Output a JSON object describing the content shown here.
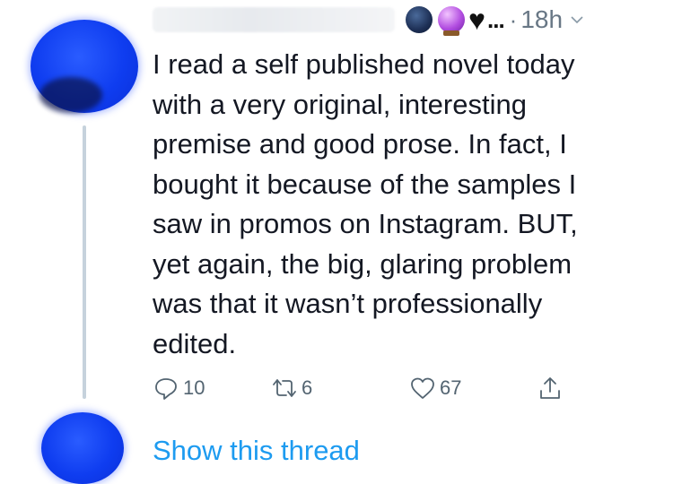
{
  "tweet": {
    "author_emojis": [
      "globe-emoji",
      "crystal-ball-emoji",
      "black-heart-emoji"
    ],
    "ellipsis": "...",
    "separator": "·",
    "timestamp": "18h",
    "text": "I read a self published novel today\nwith a very original, interesting\npremise and good prose. In fact, I\nbought it because of the samples I\nsaw in promos on Instagram. BUT,\nyet again, the big, glaring problem\nwas that it wasn’t professionally\nedited.",
    "actions": {
      "reply_count": "10",
      "retweet_count": "6",
      "like_count": "67"
    }
  },
  "thread_link": "Show this thread",
  "colors": {
    "text": "#141823",
    "muted": "#687785",
    "link": "#1d9bf0",
    "thread_line": "#c6d2dc"
  }
}
